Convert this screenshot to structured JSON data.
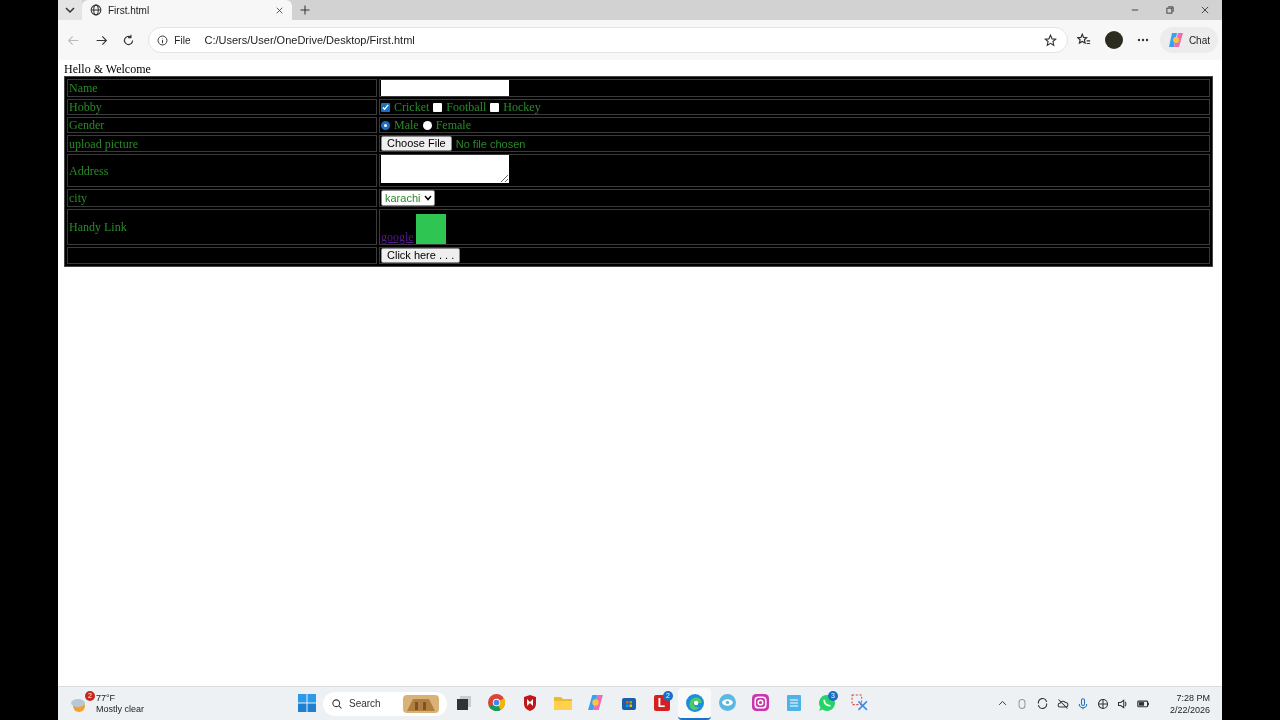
{
  "browser": {
    "tab_title": "First.html",
    "scheme": "File",
    "url": "C:/Users/User/OneDrive/Desktop/First.html",
    "chat_label": "Chat"
  },
  "page": {
    "heading": "Hello & Welcome",
    "rows": [
      {
        "kind": "text",
        "label": "Name"
      },
      {
        "kind": "checkboxes",
        "label": "Hobby",
        "options": [
          {
            "label": "Cricket",
            "checked": true
          },
          {
            "label": "Football",
            "checked": false
          },
          {
            "label": "Hockey",
            "checked": false
          }
        ]
      },
      {
        "kind": "radios",
        "label": "Gender",
        "options": [
          {
            "label": "Male",
            "selected": true
          },
          {
            "label": "Female",
            "selected": false
          }
        ]
      },
      {
        "kind": "file",
        "label": "upload picture",
        "button": "Choose File",
        "status": "No file chosen"
      },
      {
        "kind": "textarea",
        "label": "Address"
      },
      {
        "kind": "select",
        "label": "city",
        "value": "karachi"
      },
      {
        "kind": "link",
        "label": "Handy Link",
        "link": "google"
      },
      {
        "kind": "button",
        "button": "Click here . . ."
      }
    ]
  },
  "taskbar": {
    "weather": {
      "temp": "77°F",
      "condition": "Mostly clear",
      "badge": "2"
    },
    "search": "Search",
    "apps": [
      {
        "kind": "start",
        "selected": false
      },
      {
        "kind": "taskview",
        "selected": false
      },
      {
        "kind": "chrome",
        "selected": false
      },
      {
        "kind": "shield",
        "selected": false
      },
      {
        "kind": "folder",
        "selected": false
      },
      {
        "kind": "copilot",
        "selected": false
      },
      {
        "kind": "store",
        "selected": false
      },
      {
        "kind": "letter",
        "letter": "L",
        "badge": "2",
        "selected": false
      },
      {
        "kind": "edge",
        "selected": true
      },
      {
        "kind": "eye",
        "selected": false
      },
      {
        "kind": "camera",
        "selected": false
      },
      {
        "kind": "notepad",
        "selected": false
      },
      {
        "kind": "whatsapp",
        "badge": "3",
        "selected": false
      },
      {
        "kind": "snip",
        "selected": false
      }
    ],
    "clock": {
      "time": "7:28 PM",
      "date": "2/22/2026"
    }
  }
}
